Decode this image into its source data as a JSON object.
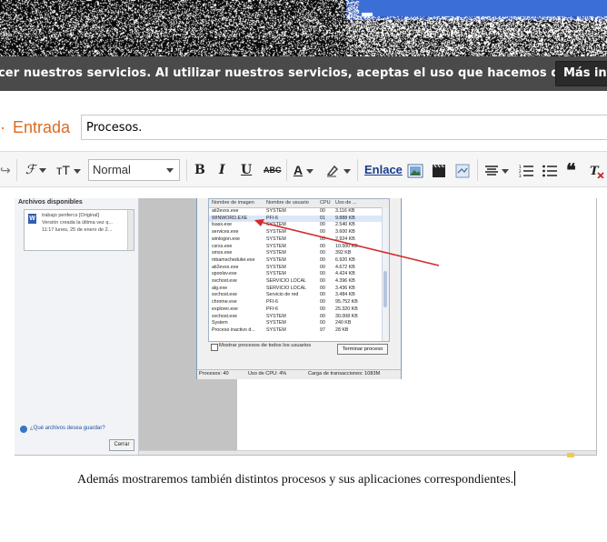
{
  "cookie_bar": {
    "text": "cer nuestros servicios. Al utilizar nuestros servicios, aceptas el uso que hacemos de las cookies.",
    "more_button": "Más info"
  },
  "post": {
    "entrada_label": "Entrada",
    "title_value": "Procesos."
  },
  "toolbar": {
    "font_glyph": "ℱ",
    "size_glyph": "тT",
    "format_value": "Normal",
    "bold": "B",
    "italic": "I",
    "underline": "U",
    "strike": "ABC",
    "text_color": "A",
    "link": "Enlace",
    "icons": [
      "undo-icon",
      "font-icon",
      "text-size-icon",
      "image-icon",
      "video-icon",
      "jump-break-icon",
      "align-icon",
      "numbered-list-icon",
      "bullet-list-icon",
      "quote-icon",
      "clear-format-icon"
    ]
  },
  "embedded_screenshot": {
    "left_panel": {
      "heading": "Archivos disponibles",
      "file_lines": [
        "trabajo penfercs [Original]",
        "Versión creada la última vez q...",
        "11:17 lunes, 25 de enero de 2..."
      ],
      "help_link": "¿Qué archivos desea guardar?",
      "cancel": "Cerrar"
    },
    "task_manager": {
      "columns": [
        "Nombre de imagen",
        "Nombre de usuario",
        "CPU",
        "Uso de ..."
      ],
      "rows": [
        [
          "ati2evxx.exe",
          "SYSTEM",
          "00",
          "3.116 KB"
        ],
        [
          "WINWORD.EXE",
          "PFI-6",
          "01",
          "9.888 KB"
        ],
        [
          "lsass.exe",
          "SYSTEM",
          "00",
          "2.540 KB"
        ],
        [
          "services.exe",
          "SYSTEM",
          "00",
          "3.600 KB"
        ],
        [
          "winlogon.exe",
          "SYSTEM",
          "00",
          "2.924 KB"
        ],
        [
          "csrss.exe",
          "SYSTEM",
          "00",
          "10.500 KB"
        ],
        [
          "smss.exe",
          "SYSTEM",
          "00",
          "392 KB"
        ],
        [
          "mbamscheduler.exe",
          "SYSTEM",
          "00",
          "6.920 KB"
        ],
        [
          "ati2evxx.exe",
          "SYSTEM",
          "00",
          "4.672 KB"
        ],
        [
          "spoolsv.exe",
          "SYSTEM",
          "00",
          "4.424 KB"
        ],
        [
          "svchost.exe",
          "SERVICIO LOCAL",
          "00",
          "4.396 KB"
        ],
        [
          "alg.exe",
          "SERVICIO LOCAL",
          "00",
          "3.436 KB"
        ],
        [
          "svchost.exe",
          "Servicio de red",
          "00",
          "3.484 KB"
        ],
        [
          "chrome.exe",
          "PFI-6",
          "00",
          "95.752 KB"
        ],
        [
          "explorer.exe",
          "PFI-6",
          "00",
          "25.320 KB"
        ],
        [
          "svchost.exe",
          "SYSTEM",
          "00",
          "30.008 KB"
        ],
        [
          "System",
          "SYSTEM",
          "00",
          "240 KB"
        ],
        [
          "Proceso inactivo d...",
          "SYSTEM",
          "97",
          "28 KB"
        ]
      ],
      "show_all_label": "Mostrar procesos de todos los usuarios",
      "end_button": "Terminar proceso",
      "status": [
        "Procesos: 40",
        "Uso de CPU: 4%",
        "Carga de transacciones: 1083M"
      ]
    }
  },
  "body_text": "Además mostraremos también distintos procesos y sus aplicaciones correspondientes."
}
